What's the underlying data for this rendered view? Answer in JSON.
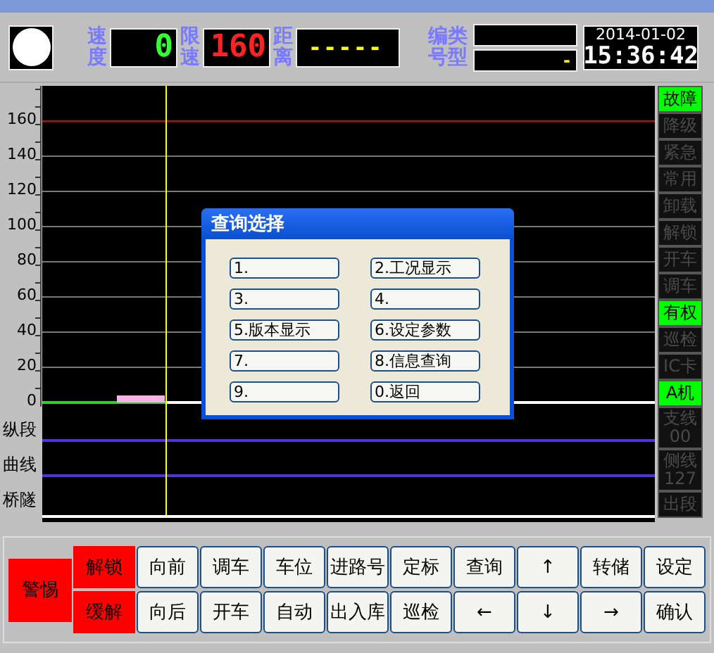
{
  "header": {
    "speed_label": "速度",
    "speed": "0",
    "limit_label": "限速",
    "limit": "160",
    "distance_label": "距离",
    "distance": "-----",
    "code_label": "编号",
    "type_label": "类型",
    "type": "-",
    "date": "2014-01-02",
    "time": "15:36:42"
  },
  "axis": {
    "ticks": [
      "160",
      "140",
      "120",
      "100",
      "80",
      "60",
      "40",
      "20",
      "0"
    ],
    "bands": [
      "纵段",
      "曲线",
      "桥隧"
    ]
  },
  "status": [
    {
      "label": "故障",
      "on": true
    },
    {
      "label": "降级",
      "on": false
    },
    {
      "label": "紧急",
      "on": false
    },
    {
      "label": "常用",
      "on": false
    },
    {
      "label": "卸载",
      "on": false
    },
    {
      "label": "解锁",
      "on": false
    },
    {
      "label": "开车",
      "on": false
    },
    {
      "label": "调车",
      "on": false
    },
    {
      "label": "有权",
      "on": true
    },
    {
      "label": "巡检",
      "on": false
    },
    {
      "label": "IC卡",
      "on": false
    },
    {
      "label": "A机",
      "on": true
    },
    {
      "label": "支线",
      "sub": "00",
      "on": false
    },
    {
      "label": "侧线",
      "sub": "127",
      "on": false
    },
    {
      "label": "出段",
      "on": false
    }
  ],
  "dialog": {
    "title": "查询选择",
    "buttons": [
      "1.",
      "2.工况显示",
      "3.",
      "4.",
      "5.版本显示",
      "6.设定参数",
      "7.",
      "8.信息查询",
      "9.",
      "0.返回"
    ]
  },
  "keys": {
    "alert": "警惕",
    "side": [
      "解锁",
      "缓解"
    ],
    "row1": [
      "向前",
      "调车",
      "车位",
      "进路号",
      "定标",
      "查询",
      "↑",
      "转储",
      "设定"
    ],
    "row2": [
      "向后",
      "开车",
      "自动",
      "出入库",
      "巡检",
      "←",
      "↓",
      "→",
      "确认"
    ]
  }
}
